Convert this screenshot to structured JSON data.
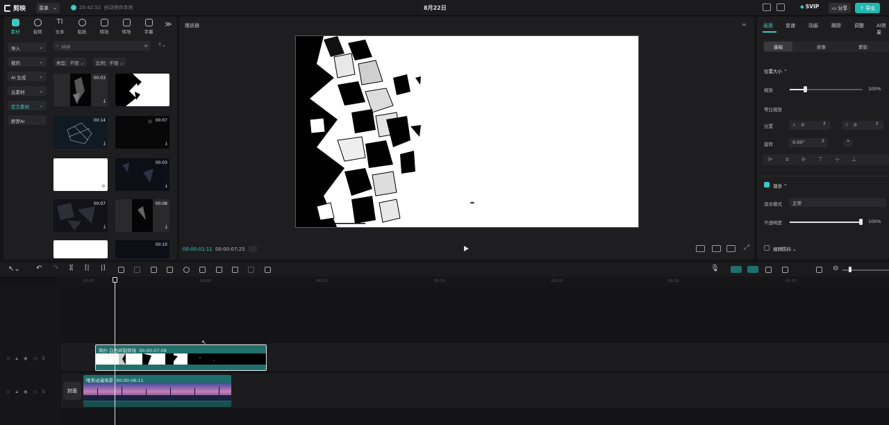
{
  "topbar": {
    "app_name": "剪映",
    "menu_label": "菜单",
    "save_time": "20:42:52",
    "save_text": "自动保存本地",
    "project_title": "8月22日",
    "svip_label": "SVIP",
    "share_label": "分享",
    "export_label": "导出"
  },
  "tools": [
    {
      "label": "素材",
      "icon": "media-icon"
    },
    {
      "label": "音频",
      "icon": "audio-icon"
    },
    {
      "label": "文本",
      "icon": "text-icon"
    },
    {
      "label": "贴纸",
      "icon": "sticker-icon"
    },
    {
      "label": "特效",
      "icon": "effects-icon"
    },
    {
      "label": "转场",
      "icon": "transition-icon"
    },
    {
      "label": "字幕",
      "icon": "caption-icon"
    }
  ],
  "categories": [
    {
      "label": "导入"
    },
    {
      "label": "我的"
    },
    {
      "label": "AI 生成"
    },
    {
      "label": "云素材"
    },
    {
      "label": "官方素材"
    },
    {
      "label": "即梦AI"
    }
  ],
  "search": {
    "value": "碎碎"
  },
  "filters": {
    "type": "类型：不限",
    "ratio": "比例：不限"
  },
  "thumbs": [
    {
      "dur": "00:03"
    },
    {
      "dur": ""
    },
    {
      "dur": "00:14"
    },
    {
      "dur": "00:07"
    },
    {
      "dur": ""
    },
    {
      "dur": "00:03"
    },
    {
      "dur": "00:07"
    },
    {
      "dur": "00:08"
    },
    {
      "dur": ""
    },
    {
      "dur": "00:10"
    }
  ],
  "player": {
    "title": "播放器",
    "current_time": "00:00:01:11",
    "total_time": "00:00:07:25"
  },
  "right_panel": {
    "tabs": [
      "画面",
      "变速",
      "动画",
      "跟踪",
      "调整",
      "AI效果"
    ],
    "subtabs": [
      "基础",
      "抠像",
      "蒙版"
    ],
    "section_position": "位置大小",
    "scale_label": "缩放",
    "scale_value": "100%",
    "uniform_label": "等比缩放",
    "pos_label": "位置",
    "pos_x_label": "X",
    "pos_x": "0",
    "pos_y_label": "Y",
    "pos_y": "0",
    "rotate_label": "旋转",
    "rotate_value": "0.00°",
    "section_blend": "混合",
    "blend_mode_label": "混合模式",
    "blend_mode_value": "正常",
    "opacity_label": "不透明度",
    "opacity_value": "100%",
    "section_stabilize": "视频防抖"
  },
  "ruler": [
    "00:00",
    "00:05",
    "00:10",
    "00:15",
    "00:20",
    "00:25",
    "00:30"
  ],
  "tracks": {
    "clip1_label": "简约 白色碎裂转场",
    "clip1_time": "00:00:07:08",
    "clip2_label": "唯美动漫场景",
    "clip2_time": "00:00:06:11",
    "cover_label": "封面"
  },
  "colors": {
    "accent": "#3ec9c0",
    "clip_teal": "#1f6f6b"
  }
}
